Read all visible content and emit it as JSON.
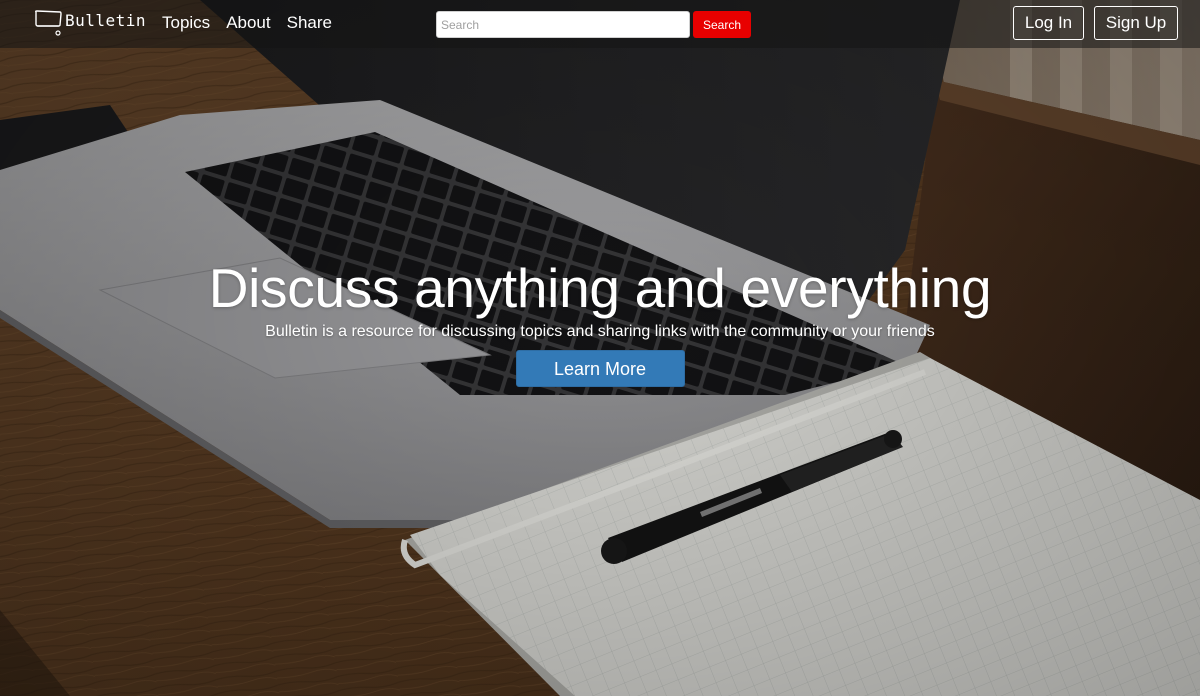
{
  "brand": {
    "name": "Bulletin"
  },
  "nav": {
    "links": [
      {
        "label": "Topics"
      },
      {
        "label": "About"
      },
      {
        "label": "Share"
      }
    ]
  },
  "search": {
    "placeholder": "Search",
    "value": "",
    "button_label": "Search"
  },
  "auth": {
    "login_label": "Log In",
    "signup_label": "Sign Up"
  },
  "hero": {
    "title": "Discuss anything and everything",
    "subtitle": "Bulletin is a resource for discussing topics and sharing links with the community or your friends",
    "cta_label": "Learn More"
  },
  "icons": {
    "logo": "monitor-logo-icon"
  },
  "colors": {
    "search_button": "#e80000",
    "cta": "#337ab7",
    "text": "#ffffff"
  }
}
